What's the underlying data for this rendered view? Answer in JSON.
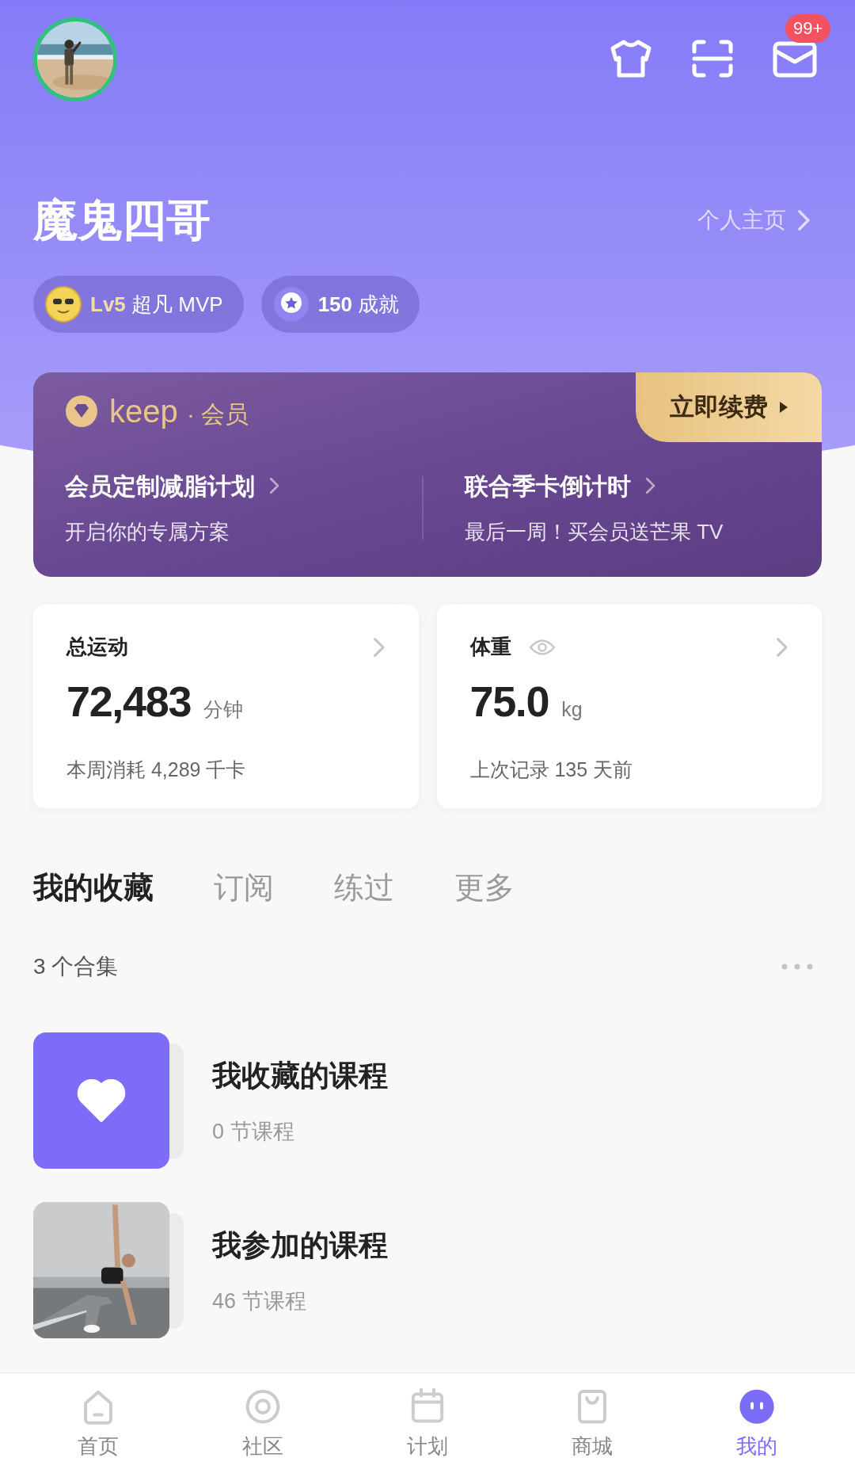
{
  "profile": {
    "name": "魔鬼四哥",
    "homepage_link": "个人主页"
  },
  "header": {
    "mail_badge": "99+"
  },
  "badges": [
    {
      "kind": "level",
      "level_text": "Lv5",
      "title": "超凡 MVP"
    },
    {
      "kind": "achievement",
      "count": "150",
      "title": "成就"
    }
  ],
  "membership": {
    "logo_text": "keep",
    "separator": "·",
    "label": "会员",
    "renew_button": "立即续费",
    "promos": [
      {
        "title": "会员定制减脂计划",
        "subtitle": "开启你的专属方案"
      },
      {
        "title": "联合季卡倒计时",
        "subtitle": "最后一周！买会员送芒果 TV"
      }
    ]
  },
  "stats": [
    {
      "kind": "exercise",
      "title": "总运动",
      "value": "72,483",
      "unit": "分钟",
      "note": "本周消耗 4,289 千卡"
    },
    {
      "kind": "weight",
      "title": "体重",
      "value": "75.0",
      "unit": "kg",
      "note": "上次记录 135 天前"
    }
  ],
  "tabs": [
    {
      "label": "我的收藏",
      "selected": true
    },
    {
      "label": "订阅",
      "selected": false
    },
    {
      "label": "练过",
      "selected": false
    },
    {
      "label": "更多",
      "selected": false
    }
  ],
  "collection_count": "3 个合集",
  "collections": [
    {
      "kind": "favorites",
      "title": "我收藏的课程",
      "subtitle": "0 节课程"
    },
    {
      "kind": "picture",
      "title": "我参加的课程",
      "subtitle": "46 节课程"
    }
  ],
  "nav": [
    {
      "label": "首页",
      "selected": false
    },
    {
      "label": "社区",
      "selected": false
    },
    {
      "label": "计划",
      "selected": false
    },
    {
      "label": "商城",
      "selected": false
    },
    {
      "label": "我的",
      "selected": true
    }
  ]
}
